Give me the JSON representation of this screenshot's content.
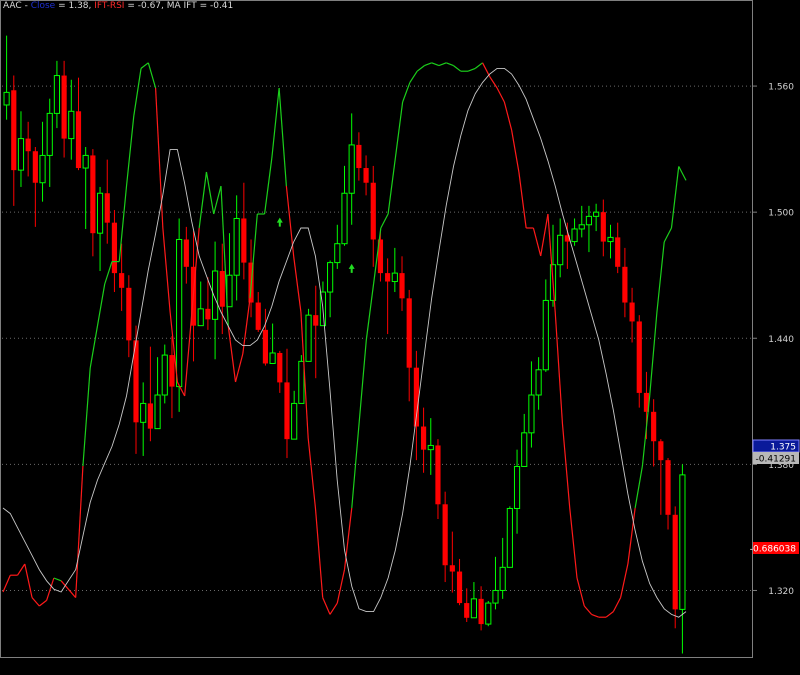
{
  "header": {
    "symbol": "AAC",
    "sep1": " - ",
    "close_label": "Close",
    "close_value": " = 1.38, ",
    "ift_label": "IFT-RSI",
    "ift_value": " = -0.67, ",
    "ma_text": "MA IFT = -0.41"
  },
  "colors": {
    "background": "#000000",
    "frame": "#7f7f7f",
    "grid": "#6a6a6a",
    "up_candle": "#00ff00",
    "down_candle": "#ff0000",
    "ift_rsi": "#ff1a1a",
    "ift_green": "#1bcf1b",
    "ma_ift": "#c8c8c8",
    "axis_text": "#d0d0d0",
    "price_tag": "#0a1a9a",
    "ma_tag": "#b8b8b8",
    "ift_tag": "#ff0000"
  },
  "chart_data": {
    "type": "candlestick",
    "ylim": [
      1.295,
      1.6
    ],
    "y_ticks": [
      "1.560",
      "1.500",
      "1.440",
      "1.380",
      "1.320"
    ],
    "tags": {
      "last_price": "1.375",
      "ma_ift": "-0.41291",
      "ift_rsi": "-0.686038"
    },
    "candles": [
      [
        1.551,
        1.557,
        1.584,
        1.544
      ],
      [
        1.558,
        1.52,
        1.565,
        1.503
      ],
      [
        1.52,
        1.535,
        1.548,
        1.512
      ],
      [
        1.535,
        1.529,
        1.543,
        1.517
      ],
      [
        1.529,
        1.514,
        1.531,
        1.493
      ],
      [
        1.514,
        1.527,
        1.543,
        1.505
      ],
      [
        1.527,
        1.547,
        1.554,
        1.512
      ],
      [
        1.547,
        1.565,
        1.572,
        1.54
      ],
      [
        1.565,
        1.535,
        1.572,
        1.526
      ],
      [
        1.535,
        1.548,
        1.563,
        1.525
      ],
      [
        1.548,
        1.521,
        1.564,
        1.52
      ],
      [
        1.521,
        1.527,
        1.531,
        1.492
      ],
      [
        1.527,
        1.49,
        1.53,
        1.479
      ],
      [
        1.49,
        1.509,
        1.512,
        1.472
      ],
      [
        1.509,
        1.495,
        1.525,
        1.485
      ],
      [
        1.495,
        1.471,
        1.501,
        1.462
      ],
      [
        1.471,
        1.464,
        1.485,
        1.453
      ],
      [
        1.464,
        1.439,
        1.47,
        1.431
      ],
      [
        1.439,
        1.4,
        1.446,
        1.385
      ],
      [
        1.4,
        1.409,
        1.419,
        1.384
      ],
      [
        1.409,
        1.397,
        1.436,
        1.391
      ],
      [
        1.397,
        1.413,
        1.431,
        1.402
      ],
      [
        1.413,
        1.432,
        1.437,
        1.409
      ],
      [
        1.432,
        1.417,
        1.441,
        1.402
      ],
      [
        1.417,
        1.487,
        1.497,
        1.405
      ],
      [
        1.487,
        1.474,
        1.493,
        1.466
      ],
      [
        1.474,
        1.446,
        1.491,
        1.429
      ],
      [
        1.446,
        1.454,
        1.467,
        1.447
      ],
      [
        1.454,
        1.449,
        1.469,
        1.444
      ],
      [
        1.449,
        1.472,
        1.486,
        1.43
      ],
      [
        1.472,
        1.455,
        1.485,
        1.442
      ],
      [
        1.455,
        1.47,
        1.49,
        1.455
      ],
      [
        1.47,
        1.497,
        1.508,
        1.458
      ],
      [
        1.497,
        1.476,
        1.514,
        1.468
      ],
      [
        1.476,
        1.457,
        1.487,
        1.45
      ],
      [
        1.457,
        1.444,
        1.462,
        1.443
      ],
      [
        1.444,
        1.428,
        1.454,
        1.427
      ],
      [
        1.428,
        1.433,
        1.447,
        1.428
      ],
      [
        1.433,
        1.419,
        1.434,
        1.414
      ],
      [
        1.419,
        1.392,
        1.435,
        1.383
      ],
      [
        1.392,
        1.409,
        1.415,
        1.395
      ],
      [
        1.409,
        1.429,
        1.432,
        1.409
      ],
      [
        1.429,
        1.451,
        1.454,
        1.429
      ],
      [
        1.451,
        1.446,
        1.465,
        1.421
      ],
      [
        1.446,
        1.462,
        1.467,
        1.446
      ],
      [
        1.462,
        1.476,
        1.477,
        1.45
      ],
      [
        1.476,
        1.485,
        1.494,
        1.473
      ],
      [
        1.485,
        1.509,
        1.522,
        1.484
      ],
      [
        1.509,
        1.532,
        1.547,
        1.494
      ],
      [
        1.532,
        1.521,
        1.538,
        1.515
      ],
      [
        1.521,
        1.514,
        1.527,
        1.508
      ],
      [
        1.514,
        1.487,
        1.522,
        1.474
      ],
      [
        1.487,
        1.471,
        1.492,
        1.467
      ],
      [
        1.471,
        1.467,
        1.478,
        1.442
      ],
      [
        1.467,
        1.471,
        1.483,
        1.462
      ],
      [
        1.471,
        1.459,
        1.479,
        1.453
      ],
      [
        1.459,
        1.426,
        1.463,
        1.41
      ],
      [
        1.426,
        1.398,
        1.434,
        1.382
      ],
      [
        1.398,
        1.387,
        1.407,
        1.376
      ],
      [
        1.387,
        1.389,
        1.402,
        1.375
      ],
      [
        1.389,
        1.361,
        1.392,
        1.354
      ],
      [
        1.361,
        1.332,
        1.367,
        1.324
      ],
      [
        1.332,
        1.329,
        1.348,
        1.319
      ],
      [
        1.329,
        1.314,
        1.335,
        1.313
      ],
      [
        1.314,
        1.307,
        1.321,
        1.305
      ],
      [
        1.307,
        1.316,
        1.324,
        1.307
      ],
      [
        1.316,
        1.304,
        1.322,
        1.301
      ],
      [
        1.304,
        1.314,
        1.315,
        1.303
      ],
      [
        1.314,
        1.32,
        1.336,
        1.311
      ],
      [
        1.32,
        1.331,
        1.345,
        1.316
      ],
      [
        1.331,
        1.359,
        1.36,
        1.332
      ],
      [
        1.359,
        1.379,
        1.387,
        1.347
      ],
      [
        1.379,
        1.395,
        1.404,
        1.38
      ],
      [
        1.395,
        1.413,
        1.429,
        1.388
      ],
      [
        1.413,
        1.425,
        1.431,
        1.406
      ],
      [
        1.425,
        1.458,
        1.468,
        1.424
      ],
      [
        1.458,
        1.475,
        1.494,
        1.455
      ],
      [
        1.475,
        1.489,
        1.497,
        1.469
      ],
      [
        1.489,
        1.486,
        1.495,
        1.473
      ],
      [
        1.486,
        1.492,
        1.497,
        1.484
      ],
      [
        1.492,
        1.494,
        1.503,
        1.488
      ],
      [
        1.494,
        1.498,
        1.503,
        1.481
      ],
      [
        1.498,
        1.5,
        1.504,
        1.491
      ],
      [
        1.5,
        1.486,
        1.506,
        1.479
      ],
      [
        1.486,
        1.488,
        1.494,
        1.478
      ],
      [
        1.488,
        1.474,
        1.495,
        1.471
      ],
      [
        1.474,
        1.457,
        1.483,
        1.45
      ],
      [
        1.457,
        1.448,
        1.464,
        1.438
      ],
      [
        1.448,
        1.414,
        1.451,
        1.407
      ],
      [
        1.414,
        1.405,
        1.424,
        1.392
      ],
      [
        1.405,
        1.391,
        1.411,
        1.379
      ],
      [
        1.391,
        1.382,
        1.392,
        1.356
      ],
      [
        1.382,
        1.356,
        1.383,
        1.349
      ],
      [
        1.356,
        1.311,
        1.36,
        1.302
      ],
      [
        1.311,
        1.375,
        1.38,
        1.29
      ]
    ],
    "series": [
      {
        "values": [
          -0.9,
          -0.84,
          -0.84,
          -0.8,
          -0.92,
          -0.95,
          -0.93,
          -0.85,
          -0.86,
          -0.89,
          -0.92,
          -0.45,
          -0.1,
          0.05,
          0.2,
          0.28,
          0.28,
          0.55,
          0.8,
          0.97,
          0.99,
          0.9,
          0.4,
          0.1,
          -0.15,
          -0.2,
          0.1,
          0.4,
          0.6,
          0.45,
          0.55,
          0.05,
          -0.15,
          -0.05,
          0.15,
          0.45,
          0.45,
          0.65,
          0.9,
          0.55,
          0.3,
          0.1,
          -0.35,
          -0.6,
          -0.92,
          -0.98,
          -0.94,
          -0.82,
          -0.6,
          -0.3,
          0.0,
          0.2,
          0.4,
          0.45,
          0.65,
          0.85,
          0.92,
          0.96,
          0.98,
          0.99,
          0.98,
          0.99,
          0.98,
          0.96,
          0.96,
          0.97,
          0.99,
          0.94,
          0.9,
          0.85,
          0.75,
          0.6,
          0.4,
          0.4,
          0.3,
          0.45,
          0.1,
          -0.3,
          -0.6,
          -0.85,
          -0.95,
          -0.98,
          -0.99,
          -0.99,
          -0.97,
          -0.92,
          -0.8,
          -0.6,
          -0.45,
          -0.2,
          0.1,
          0.35,
          0.4,
          0.62,
          0.57
        ]
      },
      {
        "values": [
          -0.6,
          -0.62,
          -0.67,
          -0.72,
          -0.77,
          -0.82,
          -0.86,
          -0.89,
          -0.9,
          -0.86,
          -0.82,
          -0.7,
          -0.58,
          -0.5,
          -0.44,
          -0.38,
          -0.3,
          -0.2,
          -0.05,
          0.1,
          0.25,
          0.38,
          0.52,
          0.68,
          0.68,
          0.56,
          0.42,
          0.3,
          0.23,
          0.16,
          0.1,
          0.05,
          0.0,
          -0.02,
          -0.02,
          0.0,
          0.05,
          0.12,
          0.21,
          0.28,
          0.35,
          0.4,
          0.4,
          0.3,
          0.12,
          -0.18,
          -0.5,
          -0.75,
          -0.88,
          -0.96,
          -0.97,
          -0.97,
          -0.92,
          -0.85,
          -0.75,
          -0.62,
          -0.45,
          -0.25,
          -0.05,
          0.15,
          0.32,
          0.48,
          0.62,
          0.73,
          0.82,
          0.88,
          0.92,
          0.95,
          0.97,
          0.97,
          0.95,
          0.91,
          0.86,
          0.79,
          0.72,
          0.64,
          0.55,
          0.45,
          0.36,
          0.27,
          0.18,
          0.09,
          0.0,
          -0.12,
          -0.25,
          -0.4,
          -0.55,
          -0.68,
          -0.79,
          -0.87,
          -0.92,
          -0.96,
          -0.98,
          -0.99,
          -0.97
        ]
      }
    ],
    "markers": [
      {
        "bar": 38,
        "price": 1.495
      },
      {
        "bar": 48,
        "price": 1.473
      }
    ]
  }
}
